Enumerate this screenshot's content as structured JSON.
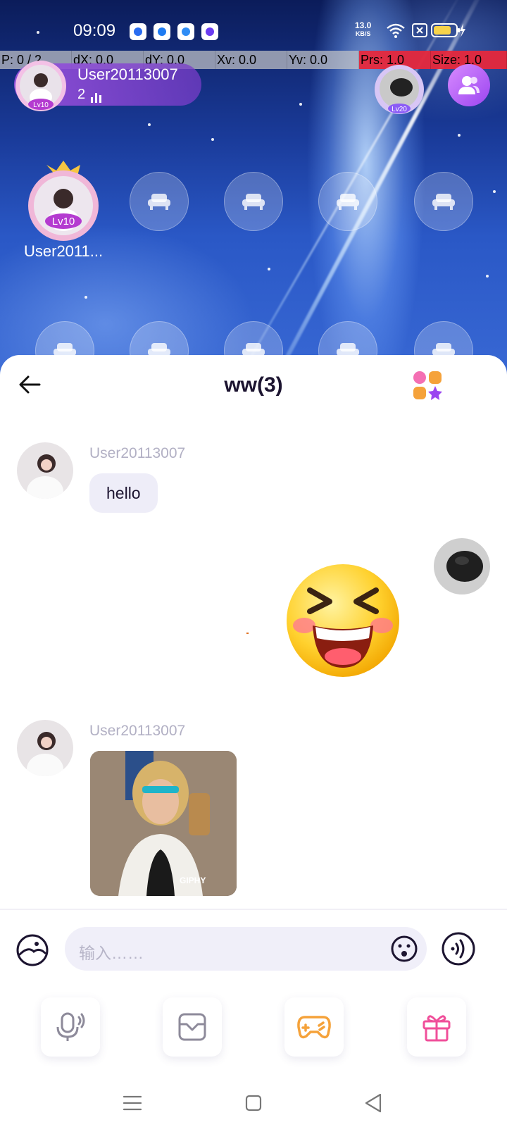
{
  "status_bar": {
    "time": "09:09",
    "net_speed_value": "13.0",
    "net_speed_unit": "KB/S"
  },
  "debug": {
    "pointers": "P: 0 / 2",
    "dx": "dX: 0.0",
    "dy": "dY: 0.0",
    "xv": "Xv: 0.0",
    "yv": "Yv: 0.0",
    "prs": "Prs: 1.0",
    "size": "Size: 1.0"
  },
  "room": {
    "host_name": "User20113007",
    "host_online_count": "2",
    "host_level": "Lv10",
    "right_level": "Lv20",
    "seat_main_level": "Lv10",
    "seat_main_name": "User2011..."
  },
  "chat": {
    "title": "ww(3)",
    "messages": [
      {
        "sender": "User20113007",
        "text": "hello"
      },
      {
        "sender": "User20113007"
      }
    ],
    "gif_caption": "GIPHY"
  },
  "composer": {
    "placeholder": "输入……"
  },
  "colors": {
    "accent_purple": "#9b45f0",
    "bubble_bg": "#eeedf8",
    "game_orange": "#f5a23a",
    "gift_pink": "#f04f9a"
  }
}
